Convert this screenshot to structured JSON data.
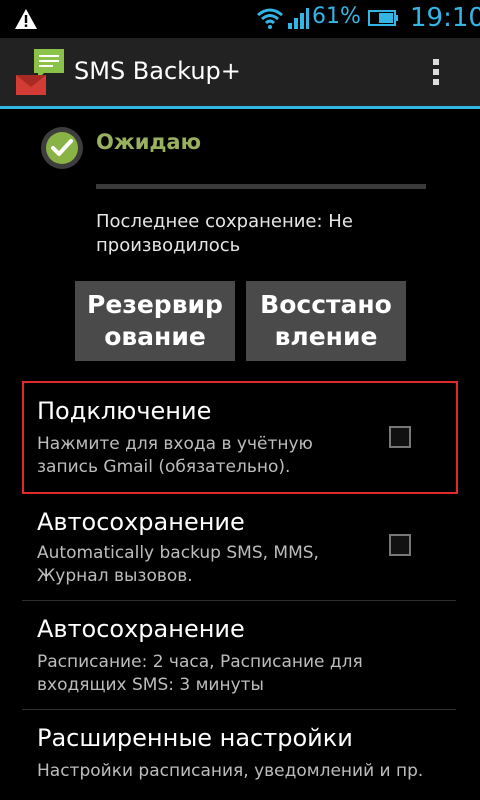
{
  "status_bar": {
    "battery_percent": "61%",
    "time": "19:10",
    "icons": [
      "warning-icon",
      "wifi-icon",
      "signal-icon",
      "battery-icon"
    ],
    "accent_color": "#33b5e5"
  },
  "action_bar": {
    "title": "SMS Backup+",
    "app_icon": "sms-backup-app-icon",
    "overflow_icon": "overflow-menu-icon"
  },
  "status": {
    "text": "Ожидаю",
    "last_backup": "Последнее сохранение: Не производилось"
  },
  "buttons": {
    "backup": "Резервирование",
    "restore": "Восстановление"
  },
  "preferences": [
    {
      "title": "Подключение",
      "summary": "Нажмите для входа в учётную запись Gmail (обязательно).",
      "checked": false
    },
    {
      "title": "Автосохранение",
      "summary": "Automatically backup SMS, MMS, Журнал вызовов.",
      "checked": false
    },
    {
      "title": "Автосохранение",
      "summary": "Расписание: 2 часа, Расписание для входящих SMS: 3 минуты"
    },
    {
      "title": "Расширенные настройки",
      "summary": "Настройки расписания, уведомлений и пр."
    }
  ]
}
